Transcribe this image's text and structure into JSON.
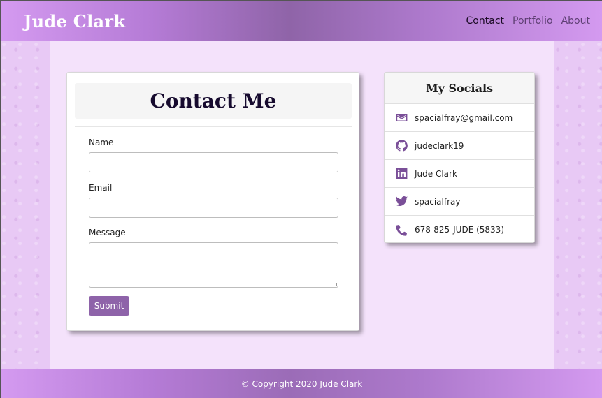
{
  "header": {
    "brand": "Jude Clark",
    "nav": [
      {
        "label": "Contact",
        "active": true
      },
      {
        "label": "Portfolio",
        "active": false
      },
      {
        "label": "About",
        "active": false
      }
    ]
  },
  "contact": {
    "title": "Contact Me",
    "fields": {
      "name_label": "Name",
      "name_value": "",
      "email_label": "Email",
      "email_value": "",
      "message_label": "Message",
      "message_value": ""
    },
    "submit_label": "Submit"
  },
  "socials": {
    "title": "My Socials",
    "items": [
      {
        "icon": "envelope-icon",
        "text": "spacialfray@gmail.com"
      },
      {
        "icon": "github-icon",
        "text": "judeclark19"
      },
      {
        "icon": "linkedin-icon",
        "text": "Jude Clark"
      },
      {
        "icon": "twitter-icon",
        "text": "spacialfray"
      },
      {
        "icon": "phone-icon",
        "text": "678-825-JUDE (5833)"
      }
    ]
  },
  "footer": {
    "text": "© Copyright 2020 Jude Clark"
  },
  "colors": {
    "accent": "#8e63a9",
    "icon": "#7a4f98",
    "nav_active": "#1a0a24",
    "nav_inactive": "#5e3f73"
  }
}
